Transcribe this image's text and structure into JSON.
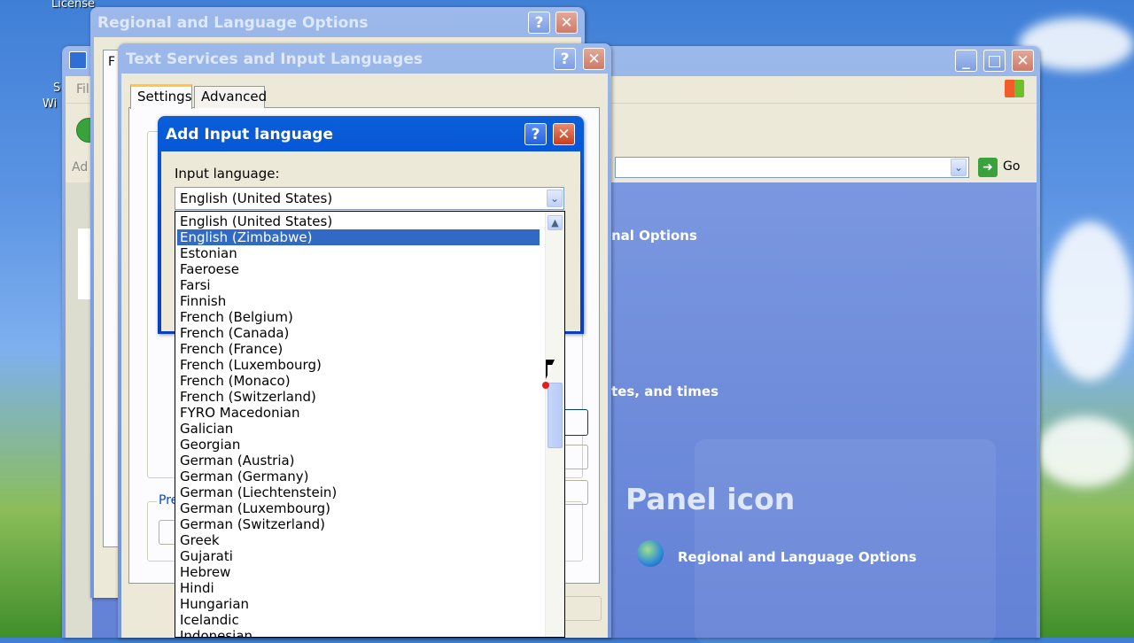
{
  "desktop": {
    "icon_label_top": "License",
    "side_label_1": "S",
    "side_label_2": "Wi"
  },
  "colors": {
    "xp_active_title": "#0046d5",
    "xp_dialog_face": "#ece9d8",
    "selection": "#316ac5",
    "control_panel_blue": "#6e8ee0"
  },
  "control_panel": {
    "menu_fragment": "Fil",
    "address_fragment": "Ad",
    "go_label": "Go",
    "link_fragment_1": "nal Options",
    "link_fragment_2": "tes, and times",
    "watermark": "Panel icon",
    "option_label": "Regional and Language Options"
  },
  "regional_window": {
    "title": "Regional and Language Options",
    "side_fragment": "F"
  },
  "text_services": {
    "title": "Text Services and Input Languages",
    "tabs": [
      "Settings",
      "Advanced"
    ],
    "prefs_fragment": "Pre"
  },
  "add_input_language": {
    "title": "Add Input language",
    "input_language_label": "Input language:",
    "selected_value": "English (United States)",
    "hovered_index": 1,
    "options": [
      "English (United States)",
      "English (Zimbabwe)",
      "Estonian",
      "Faeroese",
      "Farsi",
      "Finnish",
      "French (Belgium)",
      "French (Canada)",
      "French (France)",
      "French (Luxembourg)",
      "French (Monaco)",
      "French (Switzerland)",
      "FYRO Macedonian",
      "Galician",
      "Georgian",
      "German (Austria)",
      "German (Germany)",
      "German (Liechtenstein)",
      "German (Luxembourg)",
      "German (Switzerland)",
      "Greek",
      "Gujarati",
      "Hebrew",
      "Hindi",
      "Hungarian",
      "Icelandic",
      "Indonesian"
    ]
  },
  "icons": {
    "help": "?",
    "close": "✕",
    "minimize": "_",
    "maximize": "□",
    "dropdown": "⌄"
  }
}
